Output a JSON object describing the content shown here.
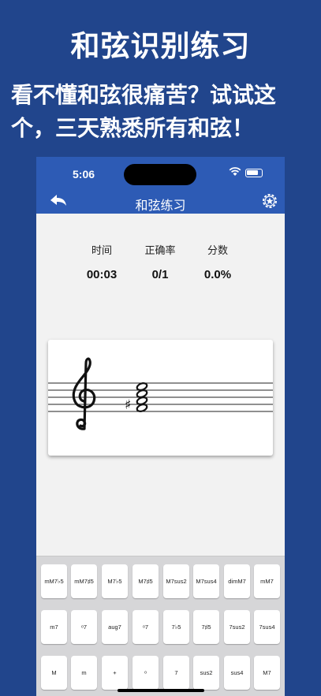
{
  "promo": {
    "title": "和弦识别练习",
    "subtitle": "看不懂和弦很痛苦？试试这个，三天熟悉所有和弦！"
  },
  "status_bar": {
    "time": "5:06"
  },
  "nav": {
    "title": "和弦练习",
    "back_icon": "back-arrow-icon",
    "settings_icon": "gear-star-icon"
  },
  "stats": {
    "time_label": "时间",
    "time_value": "00:03",
    "accuracy_label": "正确率",
    "accuracy_value": "0/1",
    "score_label": "分数",
    "score_value": "0.0%"
  },
  "staff": {
    "clef": "treble-clef",
    "accidental": "♯"
  },
  "keyboard": {
    "rows": [
      [
        "mM7♭5",
        "mM7♯5",
        "M7♭5",
        "M7♯5",
        "M7sus2",
        "M7sus4",
        "dimM7",
        "mM7"
      ],
      [
        "m7",
        "ᵒ7",
        "aug7",
        "ᵒ7",
        "7♭5",
        "7♯5",
        "7sus2",
        "7sus4"
      ],
      [
        "M",
        "m",
        "+",
        "ᵒ",
        "7",
        "sus2",
        "sus4",
        "M7"
      ]
    ]
  },
  "colors": {
    "background": "#21458c",
    "nav": "#2d5bb5"
  }
}
